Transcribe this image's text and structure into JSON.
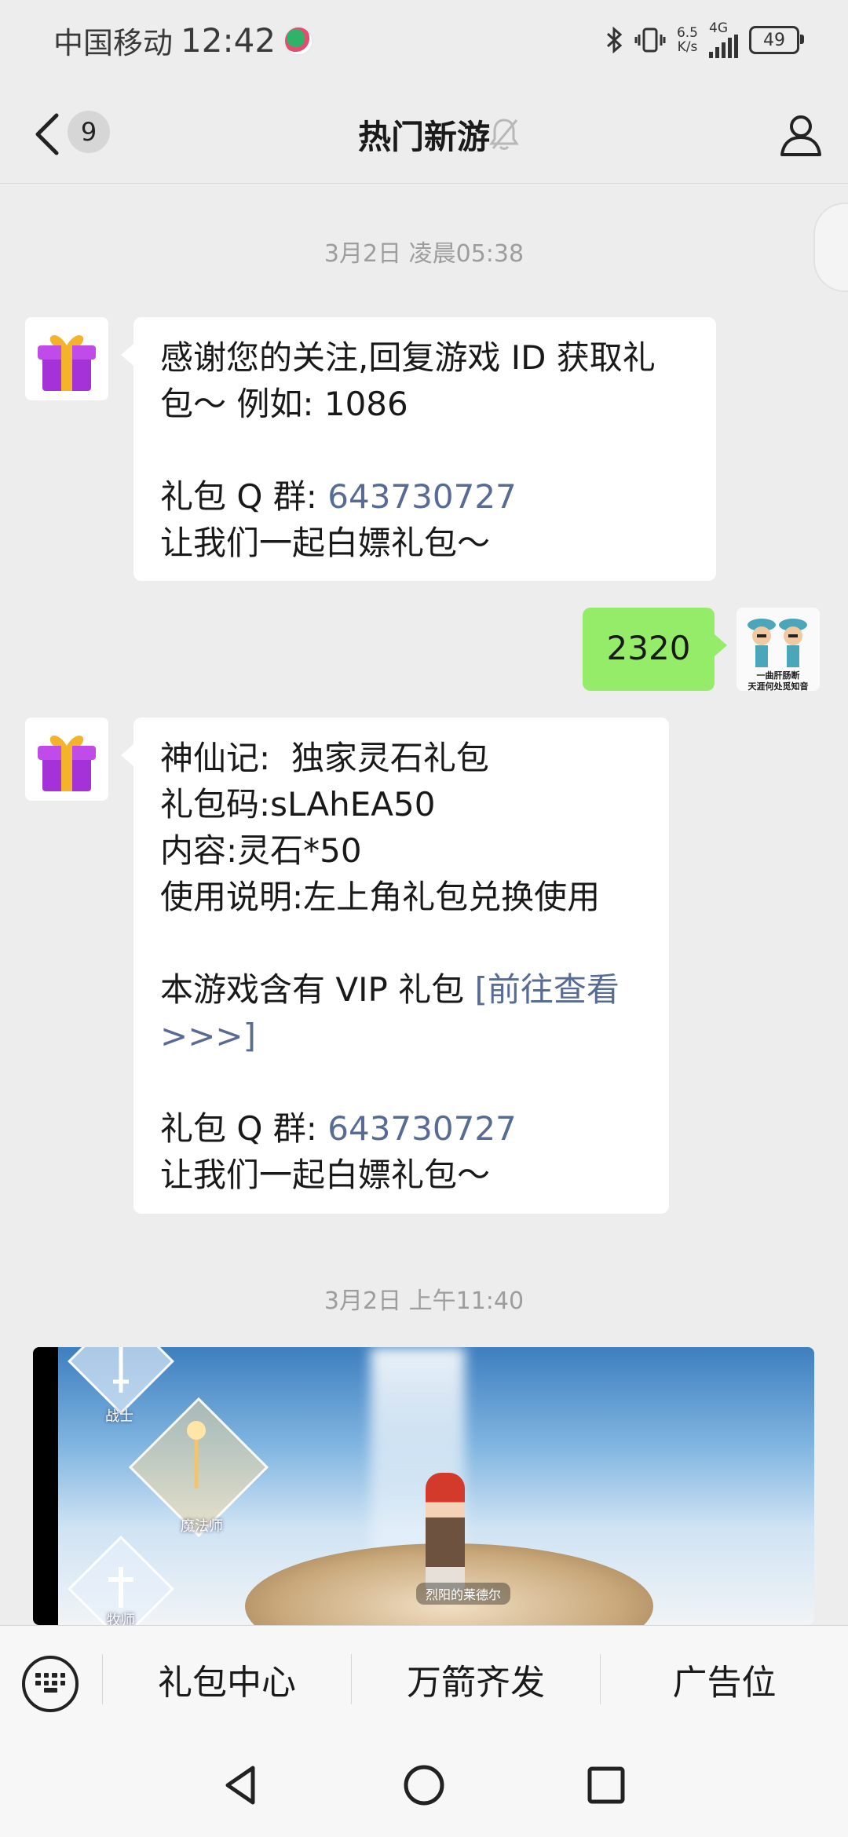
{
  "status_bar": {
    "carrier": "中国移动",
    "time": "12:42",
    "net_speed_value": "6.5",
    "net_speed_unit": "K/s",
    "network_type": "4G",
    "battery": "49"
  },
  "nav": {
    "unread_count": "9",
    "title": "热门新游"
  },
  "messages": {
    "ts1": "3月2日 凌晨05:38",
    "m1": {
      "line1": "感谢您的关注,回复游戏 ID 获取礼",
      "line2": "包～ 例如: 1086",
      "group_label": "礼包 Q 群: ",
      "group_number": "643730727",
      "closing": "让我们一起白嫖礼包～"
    },
    "m2": {
      "text": "2320"
    },
    "sender_avatar_caption_1": "一曲肝肠断",
    "sender_avatar_caption_2": "天涯何处觅知音",
    "m3": {
      "line1": "神仙记:  独家灵石礼包",
      "line2": "礼包码:sLAhEA50",
      "line3": "内容:灵石*50",
      "line4": "使用说明:左上角礼包兑换使用",
      "vip_prefix": "本游戏含有 VIP 礼包 ",
      "vip_link_1": "[前往查看",
      "vip_link_2": ">>>]",
      "group_label": "礼包 Q 群: ",
      "group_number": "643730727",
      "closing": "让我们一起白嫖礼包～"
    },
    "ts2": "3月2日 上午11:40",
    "image": {
      "class_top": "战士",
      "class_mid": "魔法师",
      "class_bot": "牧师",
      "hero_name": "烈阳的莱德尔"
    }
  },
  "menu": {
    "item1": "礼包中心",
    "item2": "万箭齐发",
    "item3": "广告位"
  },
  "colors": {
    "link": "#576b95",
    "outgoing_bubble": "#95ec69",
    "background": "#ededed"
  }
}
